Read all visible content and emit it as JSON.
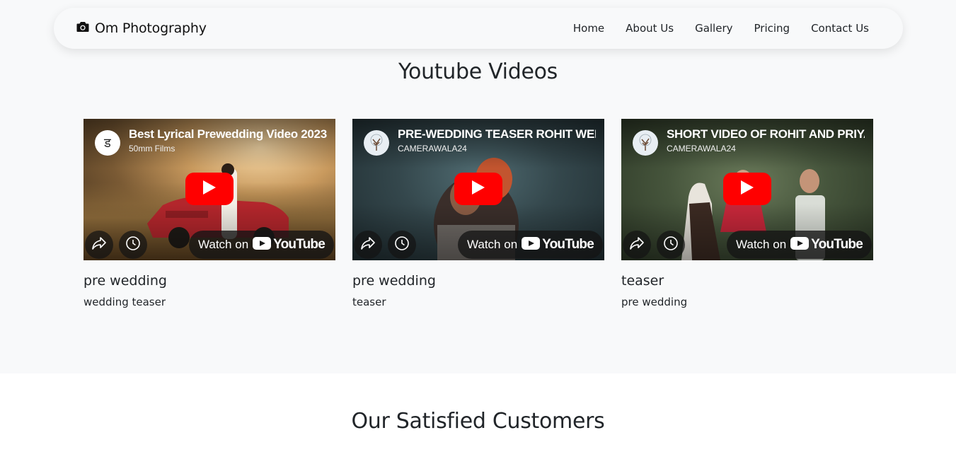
{
  "brand": {
    "name": "Om Photography",
    "icon": "camera-icon"
  },
  "nav": {
    "items": [
      "Home",
      "About Us",
      "Gallery",
      "Pricing",
      "Contact Us"
    ]
  },
  "videos_section": {
    "title": "Youtube Videos",
    "cards": [
      {
        "video_title": "Best Lyrical Prewedding Video 2023",
        "channel": "50mm Films",
        "watch_label": "Watch on",
        "youtube_label": "YouTube",
        "title": "pre wedding",
        "text": "wedding teaser"
      },
      {
        "video_title": "PRE-WEDDING TEASER ROHIT WEDS PRIYA",
        "channel": "CAMERAWALA24",
        "watch_label": "Watch on",
        "youtube_label": "YouTube",
        "title": "pre wedding",
        "text": "teaser"
      },
      {
        "video_title": "SHORT VIDEO OF ROHIT AND PRIYA",
        "channel": "CAMERAWALA24",
        "watch_label": "Watch on",
        "youtube_label": "YouTube",
        "title": "teaser",
        "text": "pre wedding"
      }
    ]
  },
  "customers_section": {
    "title": "Our Satisfied Customers"
  },
  "colors": {
    "section_bg": "#f8f9fa",
    "play_red": "#ff0000",
    "text": "#212529"
  }
}
